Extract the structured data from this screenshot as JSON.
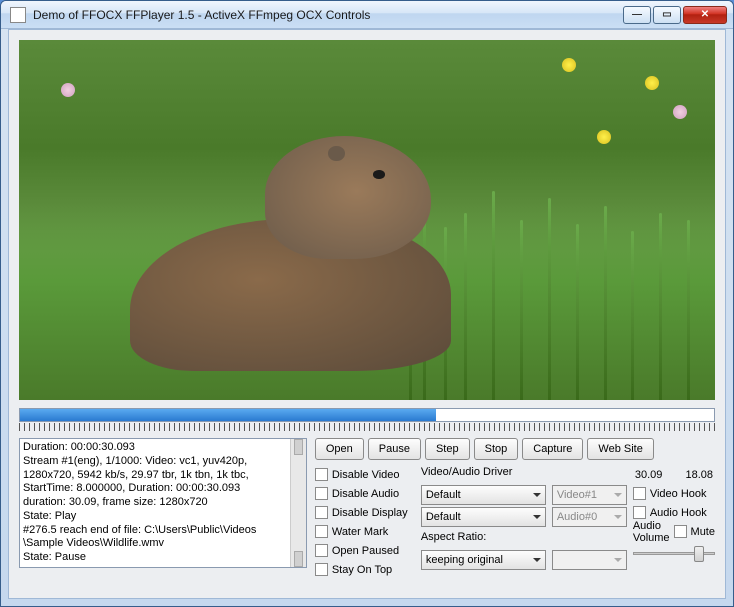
{
  "window": {
    "title": "Demo of FFOCX FFPlayer 1.5 - ActiveX FFmpeg OCX Controls"
  },
  "progress": {
    "percent": 60
  },
  "log": {
    "l1": "Duration: 00:00:30.093",
    "l2": "Stream #1(eng), 1/1000: Video: vc1, yuv420p,",
    "l3": "1280x720, 5942 kb/s, 29.97 tbr, 1k tbn, 1k tbc,",
    "l4": "StartTime: 8.000000, Duration: 00:00:30.093",
    "l5": "",
    "l6": "duration: 30.09, frame size: 1280x720",
    "l7": "State: Play",
    "l8": "#276.5 reach end of file: C:\\Users\\Public\\Videos",
    "l9": "\\Sample Videos\\Wildlife.wmv",
    "l10": "State: Pause"
  },
  "buttons": {
    "open": "Open",
    "pause": "Pause",
    "step": "Step",
    "stop": "Stop",
    "capture": "Capture",
    "website": "Web Site"
  },
  "checks": {
    "dvideo": "Disable Video",
    "daudio": "Disable Audio",
    "ddisplay": "Disable Display",
    "wmark": "Water Mark",
    "opaused": "Open Paused",
    "stayontop": "Stay On Top",
    "vhook": "Video Hook",
    "ahook": "Audio Hook",
    "mute": "Mute"
  },
  "labels": {
    "driver": "Video/Audio Driver",
    "aspect": "Aspect Ratio:",
    "volume": "Audio Volume"
  },
  "combos": {
    "vdriver": "Default",
    "adriver": "Default",
    "aspect": "keeping original",
    "vdev": "Video#1",
    "adev": "Audio#0",
    "empty": ""
  },
  "times": {
    "total": "30.09",
    "current": "18.08"
  },
  "slider": {
    "percent": 80
  }
}
